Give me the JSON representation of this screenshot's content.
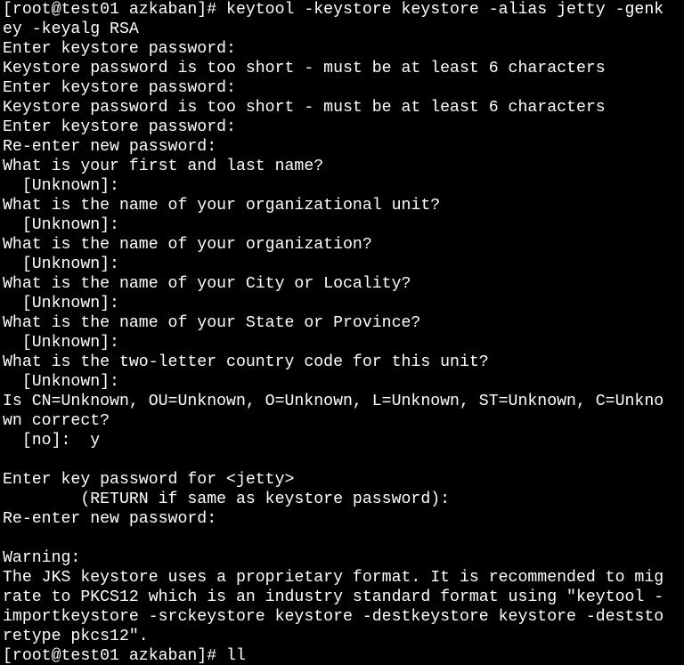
{
  "terminal": {
    "lines": [
      "[root@test01 azkaban]# keytool -keystore keystore -alias jetty -genk",
      "ey -keyalg RSA",
      "Enter keystore password:",
      "Keystore password is too short - must be at least 6 characters",
      "Enter keystore password:",
      "Keystore password is too short - must be at least 6 characters",
      "Enter keystore password:",
      "Re-enter new password:",
      "What is your first and last name?",
      "  [Unknown]:",
      "What is the name of your organizational unit?",
      "  [Unknown]:",
      "What is the name of your organization?",
      "  [Unknown]:",
      "What is the name of your City or Locality?",
      "  [Unknown]:",
      "What is the name of your State or Province?",
      "  [Unknown]:",
      "What is the two-letter country code for this unit?",
      "  [Unknown]:",
      "Is CN=Unknown, OU=Unknown, O=Unknown, L=Unknown, ST=Unknown, C=Unkno",
      "wn correct?",
      "  [no]:  y",
      "",
      "Enter key password for <jetty>",
      "        (RETURN if same as keystore password):",
      "Re-enter new password:",
      "",
      "Warning:",
      "The JKS keystore uses a proprietary format. It is recommended to mig",
      "rate to PKCS12 which is an industry standard format using \"keytool -",
      "importkeystore -srckeystore keystore -destkeystore keystore -deststo",
      "retype pkcs12\".",
      "[root@test01 azkaban]# ll"
    ]
  },
  "colors": {
    "background": "#000000",
    "foreground": "#ffffff"
  }
}
